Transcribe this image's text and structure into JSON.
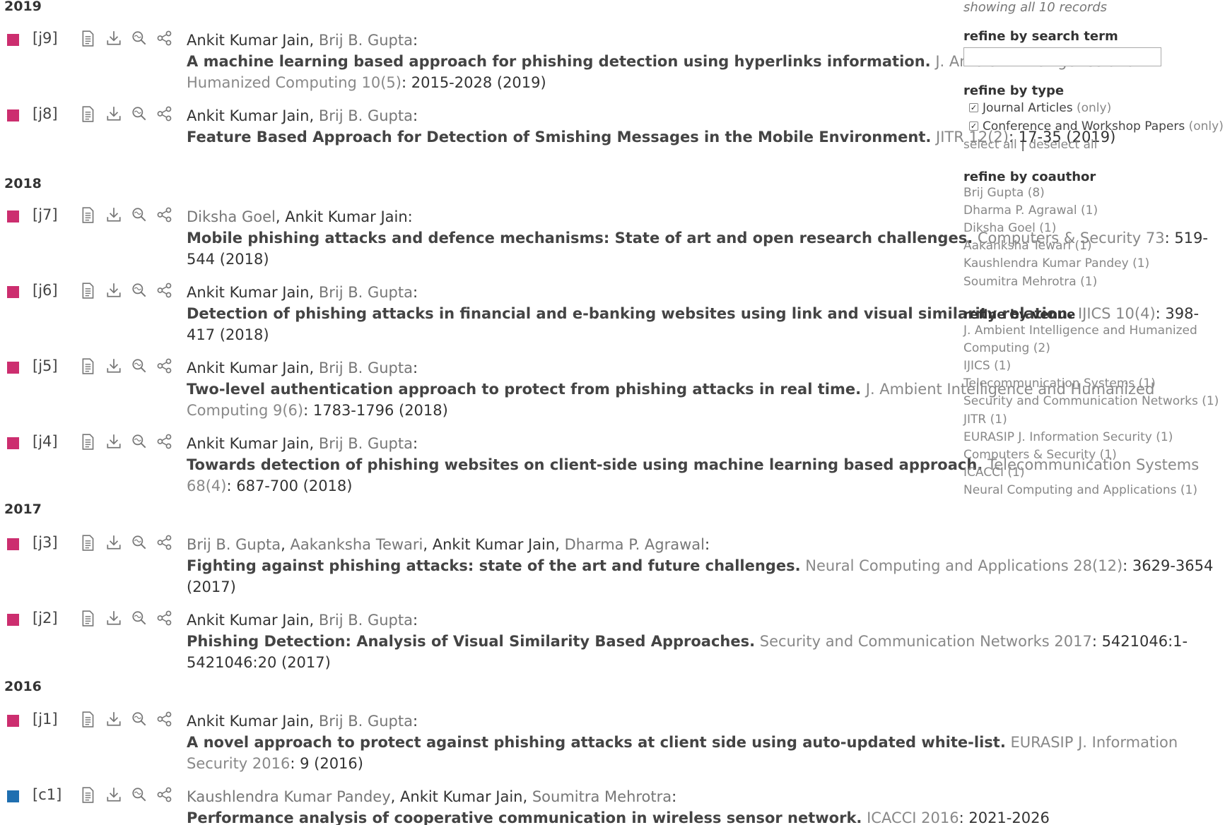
{
  "colors": {
    "journal": "#cc2e6f",
    "conference": "#1f6fb0"
  },
  "tool_icons": [
    "document-icon",
    "download-icon",
    "search-cite-icon",
    "share-icon"
  ],
  "years": [
    "2019",
    "2018",
    "2017",
    "2016"
  ],
  "entries": [
    {
      "key": "[j9]",
      "kind": "journal",
      "authors": [
        {
          "name": "Ankit Kumar Jain",
          "self": true
        },
        {
          "name": "Brij B. Gupta",
          "self": false
        }
      ],
      "title": "A machine learning based approach for phishing detection using hyperlinks information.",
      "venue": "J. Ambient Intelligence and Humanized Computing 10(5)",
      "pages": ": 2015-2028 (2019)"
    },
    {
      "key": "[j8]",
      "kind": "journal",
      "authors": [
        {
          "name": "Ankit Kumar Jain",
          "self": true
        },
        {
          "name": "Brij B. Gupta",
          "self": false
        }
      ],
      "title": "Feature Based Approach for Detection of Smishing Messages in the Mobile Environment.",
      "venue": "JITR 12(2)",
      "pages": ": 17-35 (2019)"
    },
    {
      "key": "[j7]",
      "kind": "journal",
      "authors": [
        {
          "name": "Diksha Goel",
          "self": false
        },
        {
          "name": "Ankit Kumar Jain",
          "self": true
        }
      ],
      "title": "Mobile phishing attacks and defence mechanisms: State of art and open research challenges.",
      "venue": "Computers & Security 73",
      "pages": ": 519-544 (2018)"
    },
    {
      "key": "[j6]",
      "kind": "journal",
      "authors": [
        {
          "name": "Ankit Kumar Jain",
          "self": true
        },
        {
          "name": "Brij B. Gupta",
          "self": false
        }
      ],
      "title": "Detection of phishing attacks in financial and e-banking websites using link and visual similarity relation.",
      "venue": "IJICS 10(4)",
      "pages": ": 398-417 (2018)"
    },
    {
      "key": "[j5]",
      "kind": "journal",
      "authors": [
        {
          "name": "Ankit Kumar Jain",
          "self": true
        },
        {
          "name": "Brij B. Gupta",
          "self": false
        }
      ],
      "title": "Two-level authentication approach to protect from phishing attacks in real time.",
      "venue": "J. Ambient Intelligence and Humanized Computing 9(6)",
      "pages": ": 1783-1796 (2018)"
    },
    {
      "key": "[j4]",
      "kind": "journal",
      "authors": [
        {
          "name": "Ankit Kumar Jain",
          "self": true
        },
        {
          "name": "Brij B. Gupta",
          "self": false
        }
      ],
      "title": "Towards detection of phishing websites on client-side using machine learning based approach.",
      "venue": "Telecommunication Systems 68(4)",
      "pages": ": 687-700 (2018)"
    },
    {
      "key": "[j3]",
      "kind": "journal",
      "authors": [
        {
          "name": "Brij B. Gupta",
          "self": false
        },
        {
          "name": "Aakanksha Tewari",
          "self": false
        },
        {
          "name": "Ankit Kumar Jain",
          "self": true
        },
        {
          "name": "Dharma P. Agrawal",
          "self": false
        }
      ],
      "title": "Fighting against phishing attacks: state of the art and future challenges.",
      "venue": "Neural Computing and Applications 28(12)",
      "pages": ": 3629-3654 (2017)"
    },
    {
      "key": "[j2]",
      "kind": "journal",
      "authors": [
        {
          "name": "Ankit Kumar Jain",
          "self": true
        },
        {
          "name": "Brij B. Gupta",
          "self": false
        }
      ],
      "title": "Phishing Detection: Analysis of Visual Similarity Based Approaches.",
      "venue": "Security and Communication Networks 2017",
      "pages": ": 5421046:1-5421046:20 (2017)"
    },
    {
      "key": "[j1]",
      "kind": "journal",
      "authors": [
        {
          "name": "Ankit Kumar Jain",
          "self": true
        },
        {
          "name": "Brij B. Gupta",
          "self": false
        }
      ],
      "title": "A novel approach to protect against phishing attacks at client side using auto-updated white-list.",
      "venue": "EURASIP J. Information Security 2016",
      "pages": ": 9 (2016)"
    },
    {
      "key": "[c1]",
      "kind": "conference",
      "authors": [
        {
          "name": "Kaushlendra Kumar Pandey",
          "self": false
        },
        {
          "name": "Ankit Kumar Jain",
          "self": true
        },
        {
          "name": "Soumitra Mehrotra",
          "self": false
        }
      ],
      "title": "Performance analysis of cooperative communication in wireless sensor network.",
      "venue": "ICACCI 2016",
      "pages": ": 2021-2026"
    }
  ],
  "sidebar": {
    "records": "showing all 10 records",
    "search_heading": "refine by search term",
    "search_value": "",
    "type_heading": "refine by type",
    "types": [
      {
        "label": "Journal Articles",
        "only": "(only)",
        "checked": true
      },
      {
        "label": "Conference and Workshop Papers",
        "only": "(only)",
        "checked": true
      }
    ],
    "select_all": "select all",
    "separator": "|",
    "deselect_all": "deselect all",
    "coauthor_heading": "refine by coauthor",
    "coauthors": [
      "Brij Gupta (8)",
      "Dharma P. Agrawal (1)",
      "Diksha Goel (1)",
      "Aakanksha Tewari (1)",
      "Kaushlendra Kumar Pandey (1)",
      "Soumitra Mehrotra (1)"
    ],
    "venue_heading": "refine by venue",
    "venues": [
      "J. Ambient Intelligence and Humanized",
      "Computing (2)",
      "IJICS (1)",
      "Telecommunication Systems (1)",
      "Security and Communication Networks (1)",
      "JITR (1)",
      "EURASIP J. Information Security (1)",
      "Computers & Security (1)",
      "ICACCI (1)",
      "Neural Computing and Applications (1)"
    ]
  }
}
